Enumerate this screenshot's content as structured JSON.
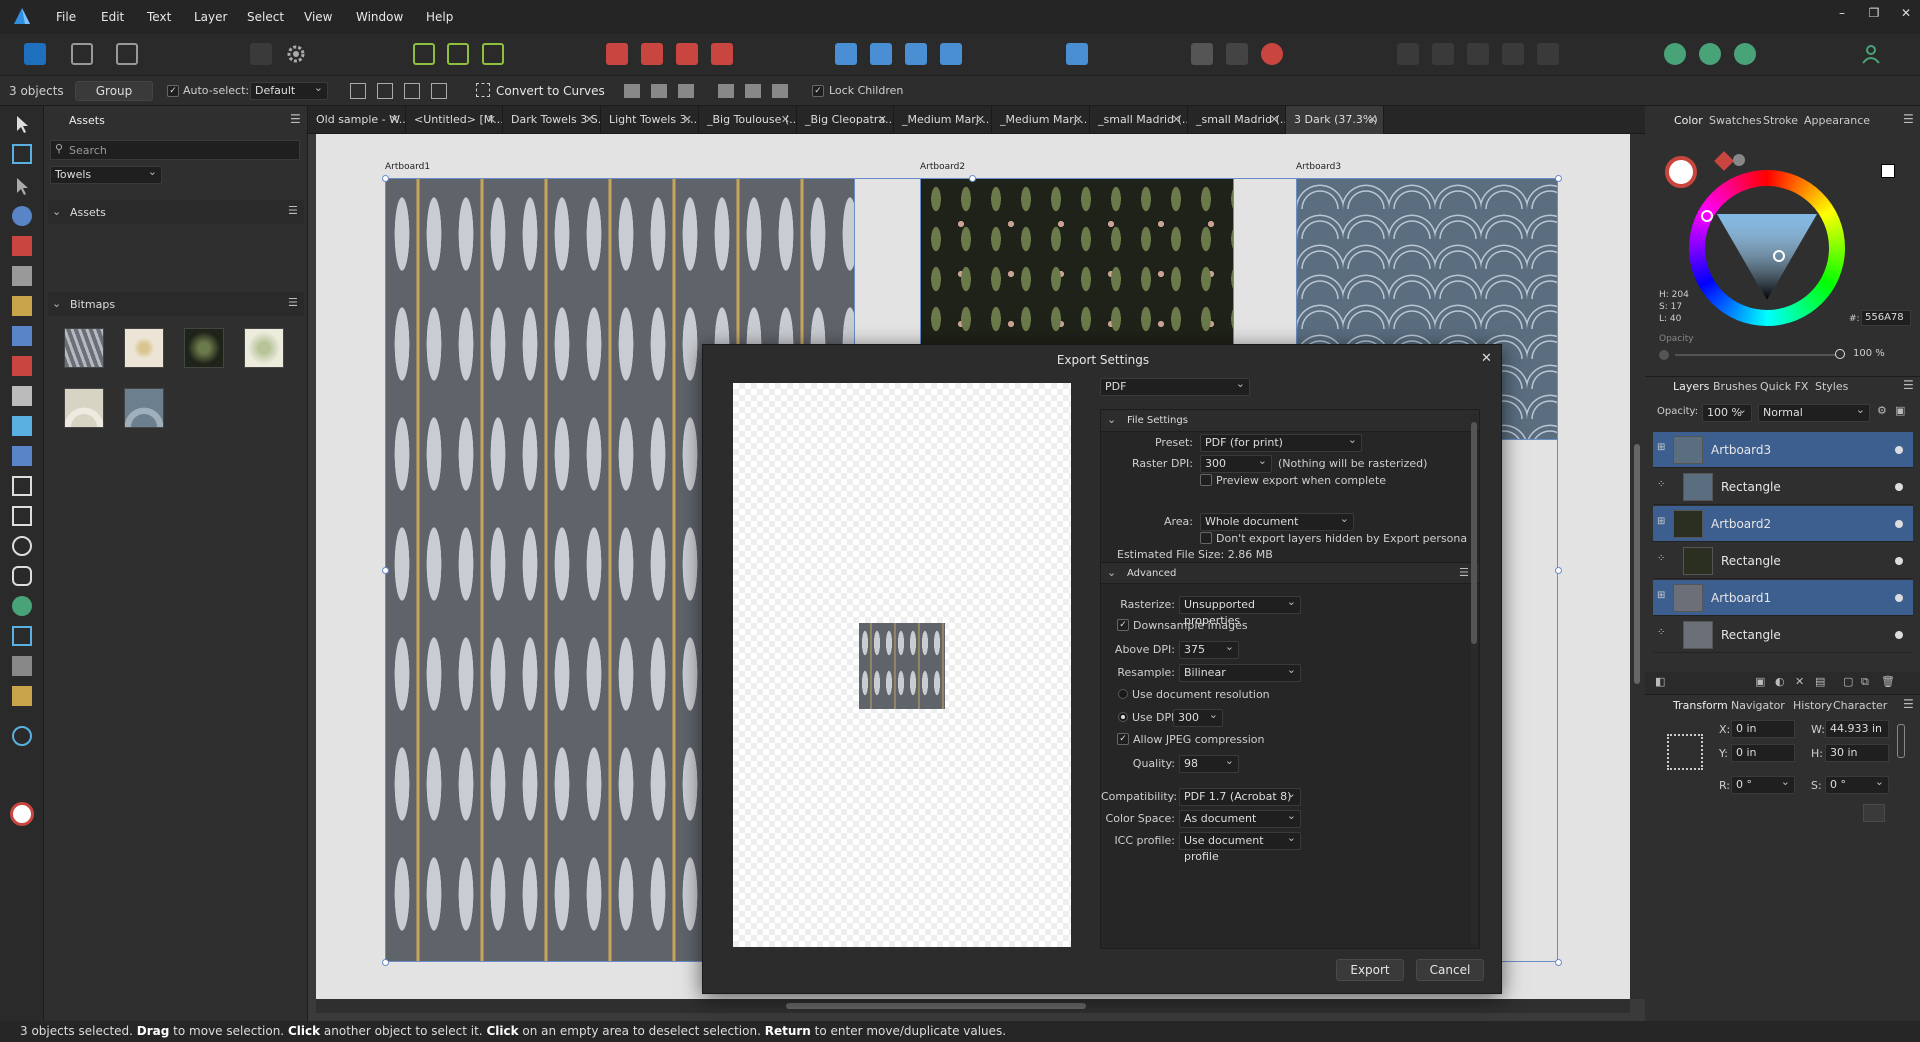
{
  "menu": {
    "items": [
      "File",
      "Edit",
      "Text",
      "Layer",
      "Select",
      "View",
      "Window",
      "Help"
    ]
  },
  "context": {
    "selection": "3 objects",
    "group": "Group",
    "auto_select": "Auto-select:",
    "auto_select_value": "Default",
    "convert": "Convert to Curves",
    "lock_children": "Lock Children"
  },
  "assets": {
    "tab": "Assets",
    "search_placeholder": "Search",
    "category": "Towels",
    "section1": "Assets",
    "section2": "Bitmaps"
  },
  "tabs": [
    "Old sample - W...",
    "<Untitled> [M...",
    "Dark Towels 3 S...",
    "Light Towels 3...",
    "_Big Toulouse (...",
    "_Big Cleopatra...",
    "_Medium Marj...",
    "_Medium Marj...",
    "_small Madrid (...",
    "_small Madrid (...",
    "3 Dark (37.3%)"
  ],
  "artboards": {
    "a1": "Artboard1",
    "a2": "Artboard2",
    "a3": "Artboard3"
  },
  "color": {
    "tabs": [
      "Color",
      "Swatches",
      "Stroke",
      "Appearance"
    ],
    "h": "H: 204",
    "s": "S: 17",
    "l": "L: 40",
    "hex_prefix": "#:",
    "hex": "556A78",
    "opacity_label": "Opacity",
    "opacity": "100 %"
  },
  "layers": {
    "tabs": [
      "Layers",
      "Brushes",
      "Quick FX",
      "Styles"
    ],
    "opacity_label": "Opacity:",
    "opacity": "100 %",
    "blend": "Normal",
    "rows": [
      {
        "name": "Artboard3"
      },
      {
        "name": "Rectangle"
      },
      {
        "name": "Artboard2"
      },
      {
        "name": "Rectangle"
      },
      {
        "name": "Artboard1"
      },
      {
        "name": "Rectangle"
      }
    ]
  },
  "transform": {
    "tabs": [
      "Transform",
      "Navigator",
      "History",
      "Character"
    ],
    "x_label": "X:",
    "x": "0 in",
    "y_label": "Y:",
    "y": "0 in",
    "w_label": "W:",
    "w": "44.933 in",
    "h_label": "H:",
    "h": "30 in",
    "r_label": "R:",
    "r": "0 °",
    "s_label": "S:",
    "s": "0 °"
  },
  "dialog": {
    "title": "Export Settings",
    "format": "PDF",
    "file_settings": "File Settings",
    "preset_label": "Preset:",
    "preset": "PDF (for print)",
    "raster_dpi_label": "Raster DPI:",
    "raster_dpi": "300",
    "raster_note": "(Nothing will be rasterized)",
    "preview_export": "Preview export when complete",
    "area_label": "Area:",
    "area": "Whole document",
    "dont_export": "Don't export layers hidden by Export persona",
    "est_size": "Estimated File Size: 2.86 MB",
    "advanced": "Advanced",
    "rasterize_label": "Rasterize:",
    "rasterize": "Unsupported properties",
    "downsample": "Downsample images",
    "above_dpi_label": "Above DPI:",
    "above_dpi": "375",
    "resample_label": "Resample:",
    "resample": "Bilinear",
    "use_doc_res": "Use document resolution",
    "use_dpi_label": "Use DPI:",
    "use_dpi": "300",
    "allow_jpeg": "Allow JPEG compression",
    "quality_label": "Quality:",
    "quality": "98",
    "compat_label": "Compatibility:",
    "compat": "PDF 1.7 (Acrobat 8)",
    "colorspace_label": "Color Space:",
    "colorspace": "As document",
    "icc_label": "ICC profile:",
    "icc": "Use document profile",
    "export": "Export",
    "cancel": "Cancel"
  },
  "status": {
    "p1": "3 objects selected. ",
    "b1": "Drag",
    "p2": " to move selection. ",
    "b2": "Click",
    "p3": " another object to select it. ",
    "b3": "Click",
    "p4": " on an empty area to deselect selection. ",
    "b4": "Return",
    "p5": " to enter move/duplicate values."
  }
}
